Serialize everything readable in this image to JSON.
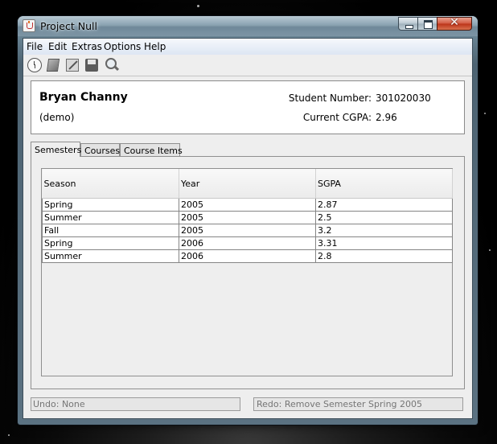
{
  "window": {
    "title": "Project Null"
  },
  "menu": {
    "items": [
      "File",
      "Edit",
      "Extras",
      "Options",
      "Help"
    ]
  },
  "toolbar": {
    "icons": [
      "clock-icon",
      "new-item-icon",
      "edit-icon",
      "save-icon",
      "search-icon"
    ]
  },
  "student": {
    "name": "Bryan Channy",
    "note": "(demo)",
    "number_label": "Student Number:",
    "number_value": "301020030",
    "cgpa_label": "Current CGPA:",
    "cgpa_value": "2.96"
  },
  "tabs": [
    {
      "label": "Semesters",
      "active": true
    },
    {
      "label": "Courses",
      "active": false
    },
    {
      "label": "Course Items",
      "active": false
    }
  ],
  "table": {
    "columns": [
      "Season",
      "Year",
      "SGPA"
    ],
    "rows": [
      [
        "Spring",
        "2005",
        "2.87"
      ],
      [
        "Summer",
        "2005",
        "2.5"
      ],
      [
        "Fall",
        "2005",
        "3.2"
      ],
      [
        "Spring",
        "2006",
        "3.31"
      ],
      [
        "Summer",
        "2006",
        "2.8"
      ]
    ]
  },
  "status": {
    "undo": "Undo: None",
    "redo": "Redo: Remove Semester Spring 2005"
  },
  "colors": {
    "menubar": "#dde6f3",
    "window_frame": "#6c8797",
    "close_button": "#c8452a"
  }
}
